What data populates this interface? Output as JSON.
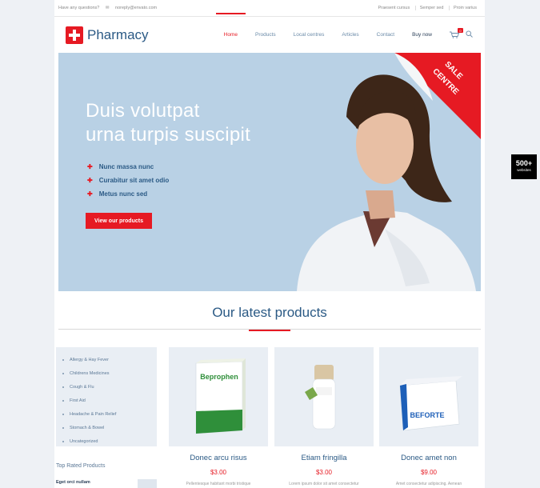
{
  "topbar": {
    "question": "Have any questions?",
    "email": "noreply@envato.com",
    "links": [
      "Praesent cursus",
      "Semper sed",
      "Proin varius"
    ]
  },
  "header": {
    "logo_text": "Pharmacy",
    "nav": [
      "Home",
      "Products",
      "Local centres",
      "Articles",
      "Contact",
      "Buy now"
    ],
    "cart_count": "0"
  },
  "hero": {
    "title_line1": "Duis volutpat",
    "title_line2": "urna turpis suscipit",
    "bullets": [
      "Nunc massa nunc",
      "Curabitur sit amet odio",
      "Metus nunc sed"
    ],
    "cta": "View our products",
    "ribbon_line1": "SALE",
    "ribbon_line2": "CENTRE"
  },
  "section_title": "Our latest products",
  "categories": [
    "Allergy & Hay Fever",
    "Childrens Medicines",
    "Cough & Flu",
    "First Aid",
    "Headache & Pain Relief",
    "Stomach & Bowel",
    "Uncategorized"
  ],
  "top_rated": {
    "title": "Top Rated Products",
    "first_item": "Eget orci nullam"
  },
  "products": [
    {
      "name": "Donec arcu risus",
      "price": "$3.00",
      "desc": "Pellentesque habitant morbi tristique",
      "box_label": "Beprophen"
    },
    {
      "name": "Etiam fringilla",
      "price": "$3.00",
      "desc": "Lorem ipsum dolor sit amet consectetur",
      "box_label": ""
    },
    {
      "name": "Donec amet non",
      "price": "$9.00",
      "desc": "Amet consectetur adipiscing. Aenean",
      "box_label": "BEFORTE"
    }
  ],
  "promo_badge": {
    "number": "500+",
    "label": "websites"
  },
  "colors": {
    "accent": "#e61a23",
    "brand": "#2b5a85",
    "hero_bg": "#b9d1e5"
  }
}
